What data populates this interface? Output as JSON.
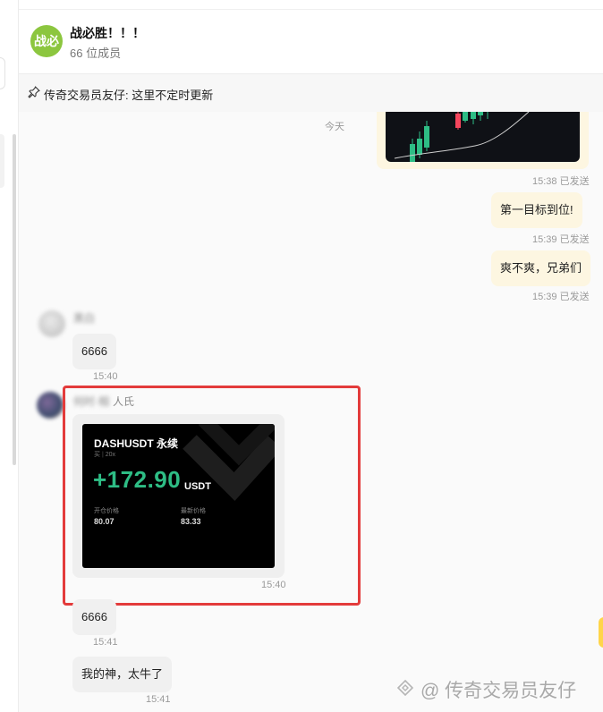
{
  "group": {
    "avatar_text": "战必",
    "title": "战必胜！！！",
    "member_count": "66 位成员"
  },
  "pinned": {
    "text": "传奇交易员友仔: 这里不定时更新"
  },
  "date_separator": "今天",
  "messages": {
    "chart_time": "15:38 已发送",
    "out1": {
      "text": "第一目标到位!",
      "time": "15:39 已发送"
    },
    "out2": {
      "text": "爽不爽，兄弟们",
      "time": "15:39 已发送"
    },
    "in1": {
      "sender": "黑白",
      "text": "6666",
      "time": "15:40"
    },
    "card_msg": {
      "sender_blurred": "何时·相",
      "sender_tail": "人氏",
      "time": "15:40"
    },
    "in3": {
      "text": "6666",
      "time": "15:41"
    },
    "in4": {
      "text": "我的神，太牛了",
      "time": "15:41"
    }
  },
  "pnl_card": {
    "symbol": "DASHUSDT 永续",
    "side": "买",
    "leverage": "20x",
    "pnl": "+172.90",
    "unit": "USDT",
    "open_price_label": "开仓价格",
    "open_price": "80.07",
    "latest_price_label": "最新价格",
    "latest_price": "83.33",
    "accent_color": "#2ebd85"
  },
  "watermark": {
    "text": "@ 传奇交易员友仔"
  }
}
